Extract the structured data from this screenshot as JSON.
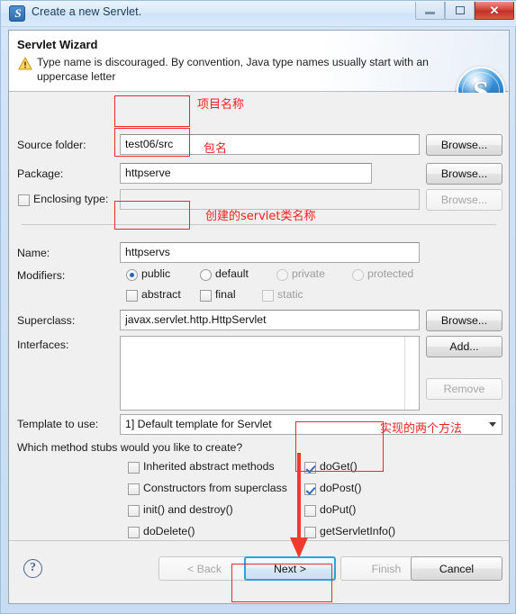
{
  "window": {
    "title": "Create a new Servlet.",
    "icon": "servlet-app-icon",
    "controls": {
      "minimize": "minimize-icon",
      "maximize": "maximize-icon",
      "close": "close-icon"
    }
  },
  "header": {
    "title": "Servlet Wizard",
    "warning_icon": "warning-triangle-icon",
    "message": "Type name is discouraged. By convention, Java type names usually start with an uppercase letter",
    "logo": "S"
  },
  "form": {
    "source_folder": {
      "label": "Source folder:",
      "value": "test06/src",
      "browse": "Browse..."
    },
    "package": {
      "label": "Package:",
      "value": "httpserve",
      "browse": "Browse..."
    },
    "enclosing_type": {
      "label": "Enclosing type:",
      "value": "",
      "checked": false,
      "browse": "Browse..."
    },
    "name": {
      "label": "Name:",
      "value": "httpservs"
    },
    "modifiers": {
      "label": "Modifiers:",
      "access": [
        {
          "label": "public",
          "selected": true,
          "enabled": true
        },
        {
          "label": "default",
          "selected": false,
          "enabled": true
        },
        {
          "label": "private",
          "selected": false,
          "enabled": false
        },
        {
          "label": "protected",
          "selected": false,
          "enabled": false
        }
      ],
      "flags": [
        {
          "label": "abstract",
          "checked": false,
          "enabled": true
        },
        {
          "label": "final",
          "checked": false,
          "enabled": true
        },
        {
          "label": "static",
          "checked": false,
          "enabled": false
        }
      ]
    },
    "superclass": {
      "label": "Superclass:",
      "value": "javax.servlet.http.HttpServlet",
      "browse": "Browse..."
    },
    "interfaces": {
      "label": "Interfaces:",
      "items": [],
      "add": "Add...",
      "remove": "Remove"
    },
    "template": {
      "label": "Template to use:",
      "value": "1] Default template for Servlet"
    },
    "stubs": {
      "question": "Which method stubs would you like to create?",
      "left": [
        {
          "label": "Inherited abstract methods",
          "checked": false
        },
        {
          "label": "Constructors from superclass",
          "checked": false
        },
        {
          "label": "init() and destroy()",
          "checked": false
        },
        {
          "label": "doDelete()",
          "checked": false
        }
      ],
      "right": [
        {
          "label": "doGet()",
          "checked": true
        },
        {
          "label": "doPost()",
          "checked": true
        },
        {
          "label": "doPut()",
          "checked": false
        },
        {
          "label": "getServletInfo()",
          "checked": false
        }
      ]
    }
  },
  "footer": {
    "help": "?",
    "back": "< Back",
    "next": "Next >",
    "finish": "Finish",
    "cancel": "Cancel"
  },
  "annotations": {
    "color": "#ef2020",
    "source_folder_note": "项目名称",
    "package_note": "包名",
    "name_note": "创建的servlet类名称",
    "methods_note": "实现的两个方法"
  }
}
